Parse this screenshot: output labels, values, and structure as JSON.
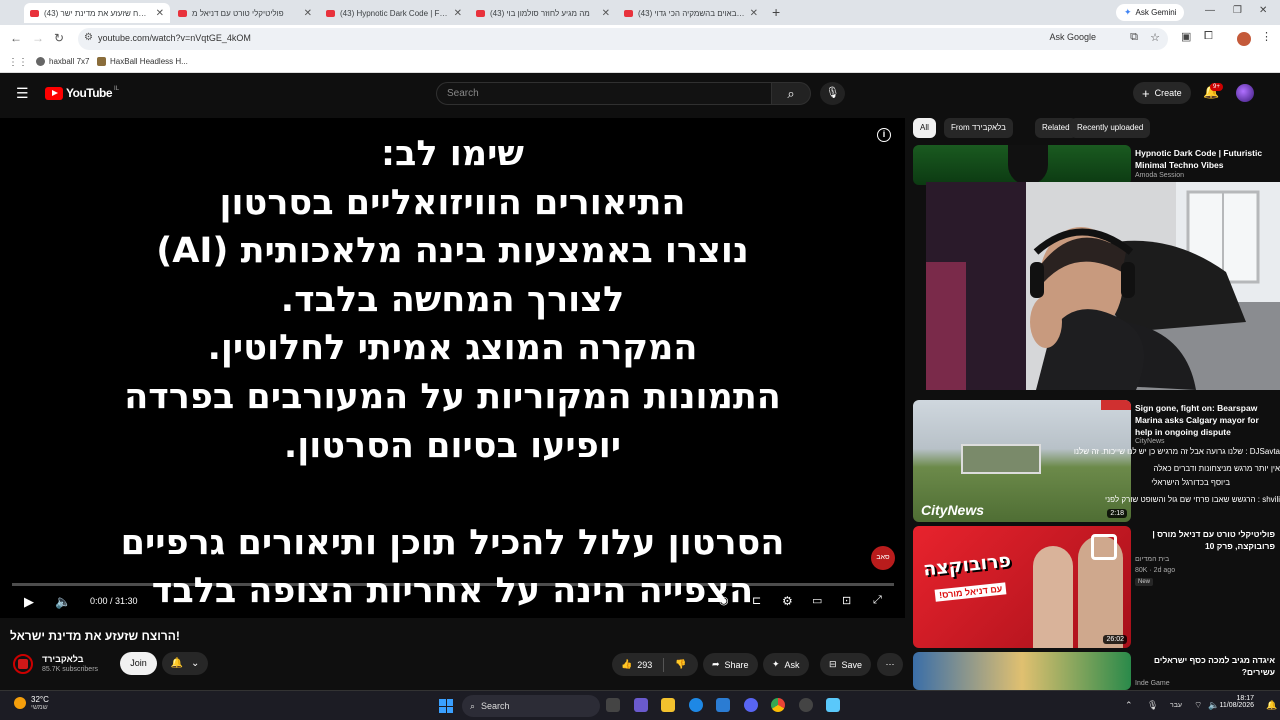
{
  "browser": {
    "tabs": [
      {
        "label": "(43) הרוצח שזעזע את מדינת ישר",
        "active": true
      },
      {
        "label": "פוליטיקלי טורט עם דניאל מ",
        "active": false
      },
      {
        "label": "(43) Hypnotic Dark Code | Futur",
        "active": false
      },
      {
        "label": "(43) מה מגיע לחוזר סולמון בוי",
        "active": false
      },
      {
        "label": "(43) חרבאוים בהשמקיה הכי גדוי",
        "active": false
      }
    ],
    "new_tab": "+",
    "gemini_label": "Ask Gemini",
    "url": "youtube.com/watch?v=nVqtGE_4kOM",
    "ask_google": "Ask Google",
    "bookmarks": [
      "haxball 7x7",
      "HaxBall Headless H..."
    ]
  },
  "youtube": {
    "logo_text": "YouTube",
    "logo_country": "IL",
    "search_placeholder": "Search",
    "create_label": "Create",
    "notifications_badge": "9+"
  },
  "player": {
    "notice_lines": [
      "שימו לב:",
      "התיאורים הוויזואליים בסרטון",
      "נוצרו באמצעות בינה מלאכותית (AI)",
      "לצורך המחשה בלבד.",
      "המקרה המוצג אמיתי לחלוטין.",
      "התמונות המקוריות על המעורבים בפרדה",
      "יופיעו בסיום הסרטון.",
      "",
      "הסרטון עלול להכיל תוכן ותיאורים גרפיים",
      "הצפייה הינה על אחריות הצופה בלבד"
    ],
    "watermark": "סאב",
    "time": "0:00 / 31:30",
    "progress": 0
  },
  "video": {
    "title": "הרוצח שזעזע את מדינת ישראל!",
    "channel": "בלאקבירד",
    "subscribers": "85.7K subscribers",
    "join_label": "Join",
    "likes": "293",
    "share_label": "Share",
    "ask_label": "Ask",
    "save_label": "Save"
  },
  "sidebar": {
    "chips": [
      "All",
      "From בלאקבירד",
      "Related",
      "Recently uploaded"
    ],
    "videos": [
      {
        "title": "Hypnotic Dark Code | Futuristic Minimal Techno Vibes",
        "channel": "Amoda Session",
        "meta": "",
        "duration": ""
      },
      {
        "title": "Sign gone, fight on: Bearspaw Marina asks Calgary mayor for help in ongoing dispute",
        "channel": "CityNews",
        "meta": "",
        "duration": "2:18"
      },
      {
        "title": "פוליטיקלי טורט עם דניאל מורס | פרובוקצה, פרק 10",
        "channel": "בית המדיום",
        "meta": "80K · 2d ago",
        "badge": "New",
        "duration": "26:02"
      },
      {
        "title": "איגדה מגיב למכה כסף ישראלים עשירים?",
        "channel": "Inde Game",
        "meta": "",
        "duration": ""
      }
    ],
    "citynews_logo": "CityNews",
    "thumb_text": "פרובוקצה",
    "thumb_subtext": "עם דניאל מורס!",
    "chat_lines": [
      "DJSavta : שלנו גרועה אבל זה מרגיש כן יש לנו שייכות. זה שלנו",
      "אין יותר מרגש מניצחונות ודברים כאלה",
      "ביוסף בכדורגל הישראלי",
      "shvili : הרגשש שאבו פרחי שם גול והשופט שורק לפני"
    ]
  },
  "taskbar": {
    "temp": "32°C",
    "weather_desc": "שמשי",
    "search_label": "Search",
    "time": "18:17",
    "date": "11/08/2026",
    "lang": "עבר"
  }
}
